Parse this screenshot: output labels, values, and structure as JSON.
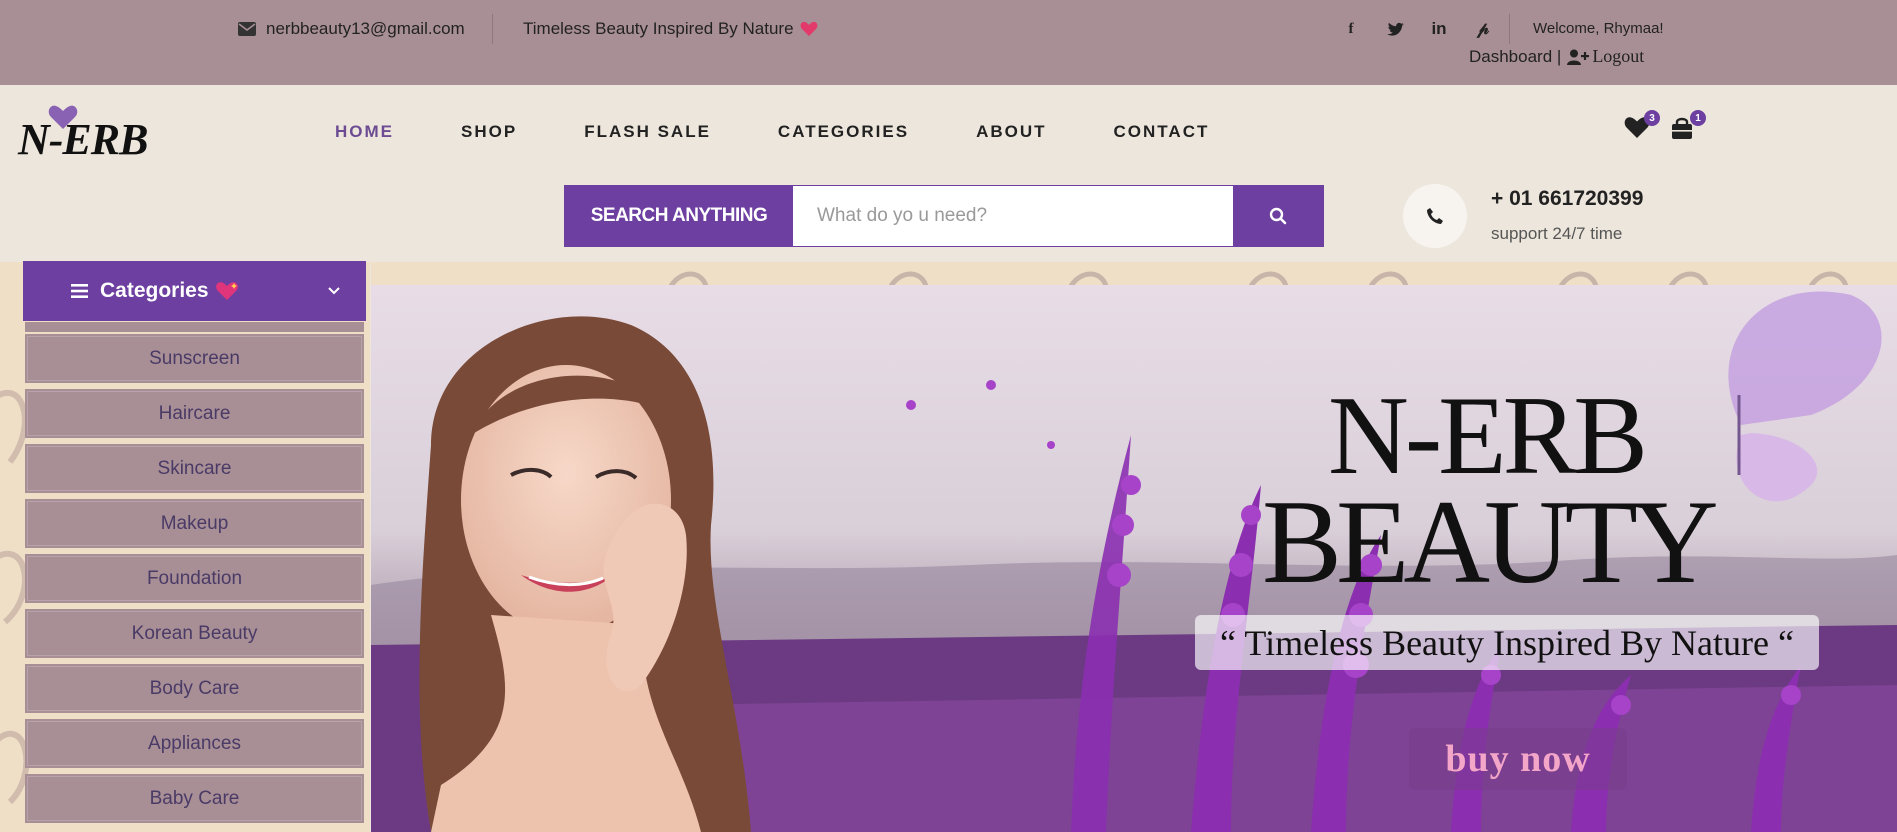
{
  "topbar": {
    "email": "nerbbeauty13@gmail.com",
    "tagline": "Timeless Beauty Inspired By Nature",
    "tagline_icon": "heart-icon",
    "social": [
      "facebook-icon",
      "twitter-icon",
      "linkedin-icon",
      "pinterest-icon"
    ],
    "welcome": "Welcome, Rhymaa!",
    "dashboard": "Dashboard |",
    "logout": "Logout"
  },
  "header": {
    "logo": "N-ERB",
    "nav": [
      "HOME",
      "SHOP",
      "FLASH SALE",
      "CATEGORIES",
      "ABOUT",
      "CONTACT"
    ],
    "active_nav": "HOME",
    "wishlist_count": "3",
    "cart_count": "1"
  },
  "search": {
    "label": "SEARCH ANYTHING",
    "placeholder": "What do yo u need?"
  },
  "support": {
    "phone": "+ 01 661720399",
    "text": "support 24/7 time"
  },
  "categories": {
    "title": "Categories",
    "items": [
      "Sunscreen",
      "Haircare",
      "Skincare",
      "Makeup",
      "Foundation",
      "Korean Beauty",
      "Body Care",
      "Appliances",
      "Baby Care"
    ]
  },
  "banner": {
    "title_line1": "N-ERB",
    "title_line2": "BEAUTY",
    "quote": "“ Timeless Beauty Inspired By Nature “",
    "cta": "buy now"
  },
  "colors": {
    "topbar": "#a88f96",
    "accent": "#6c3fa0",
    "header_bg": "#ede6dc",
    "category_item": "#a88f96"
  }
}
